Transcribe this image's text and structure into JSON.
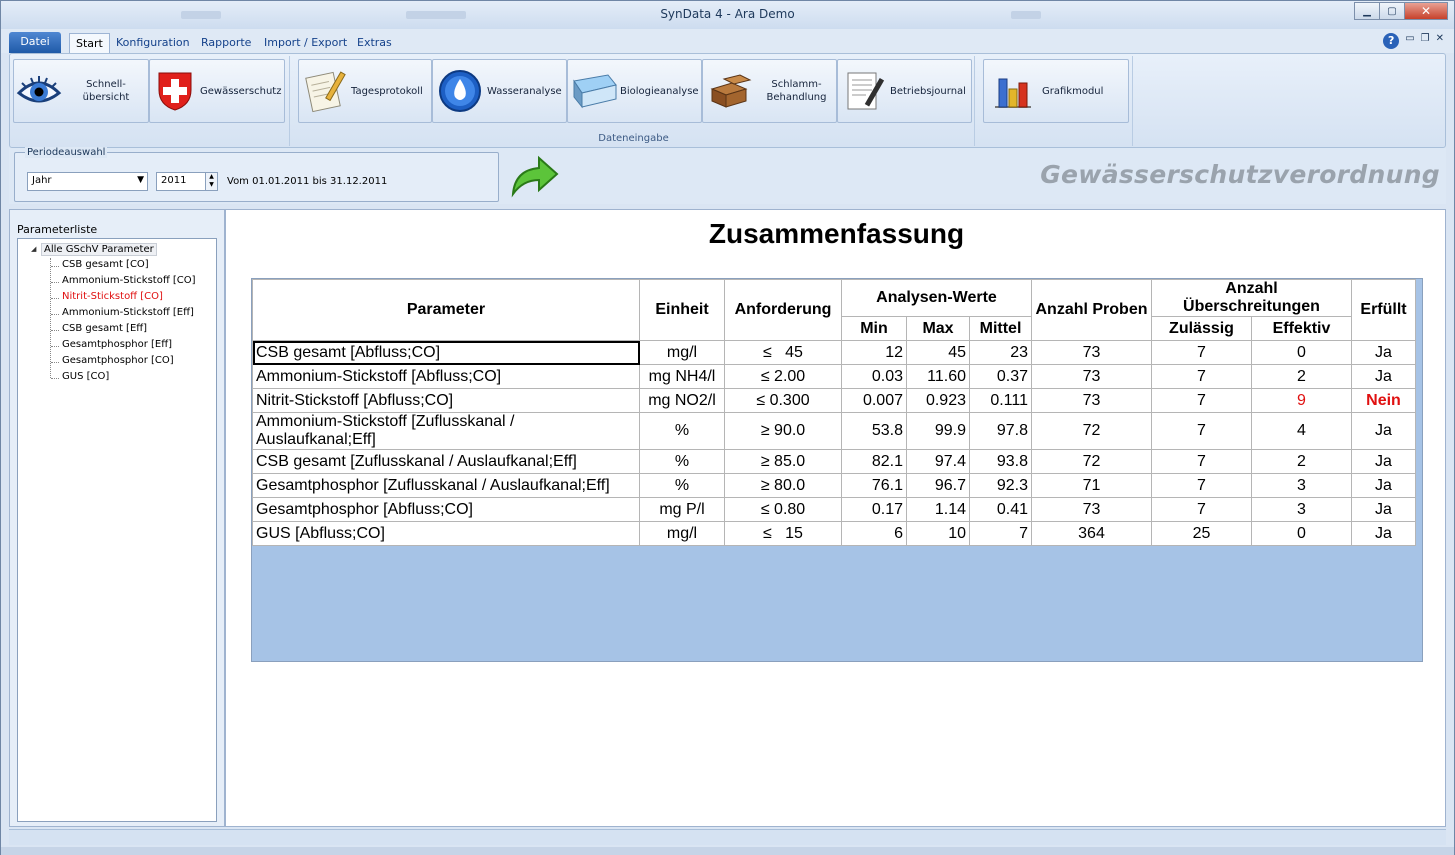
{
  "window": {
    "title": "SynData 4 - Ara Demo"
  },
  "menu": {
    "datei": "Datei",
    "tabs": [
      "Start",
      "Konfiguration",
      "Rapporte",
      "Import / Export",
      "Extras"
    ]
  },
  "ribbon": {
    "schnell": "Schnell-\nübersicht",
    "gewaesser": "Gewässerschutz",
    "tagesprotokoll": "Tagesprotokoll",
    "wasseranalyse": "Wasseranalyse",
    "biologieanalyse": "Biologieanalyse",
    "schlamm": "Schlamm-\nBehandlung",
    "betriebsjournal": "Betriebsjournal",
    "grafikmodul": "Grafikmodul",
    "group_dateneingabe": "Dateneingabe"
  },
  "period": {
    "legend": "Periodeauswahl",
    "mode": "Jahr",
    "year": "2011",
    "range": "Vom 01.01.2011 bis 31.12.2011"
  },
  "banner": "Gewässerschutzverordnung",
  "left": {
    "label": "Parameterliste",
    "root": "Alle GSchV Parameter",
    "items": [
      "CSB gesamt [CO]",
      "Ammonium-Stickstoff [CO]",
      "Nitrit-Stickstoff [CO]",
      "Ammonium-Stickstoff [Eff]",
      "CSB gesamt [Eff]",
      "Gesamtphosphor [Eff]",
      "Gesamtphosphor [CO]",
      "GUS [CO]"
    ],
    "highlight_color": "#e01010"
  },
  "summary": {
    "title": "Zusammenfassung",
    "headers": {
      "parameter": "Parameter",
      "einheit": "Einheit",
      "anforderung": "Anforderung",
      "analysen": "Analysen-Werte",
      "min": "Min",
      "max": "Max",
      "mittel": "Mittel",
      "proben": "Anzahl Proben",
      "ueber": "Anzahl Überschreitungen",
      "zulaessig": "Zulässig",
      "effektiv": "Effektiv",
      "erfuellt": "Erfüllt"
    },
    "rows": [
      [
        "CSB gesamt [Abfluss;CO]",
        "mg/l",
        "≤   45",
        "12",
        "45",
        "23",
        "73",
        "7",
        "0",
        "Ja"
      ],
      [
        "Ammonium-Stickstoff [Abfluss;CO]",
        "mg NH4/l",
        "≤ 2.00",
        "0.03",
        "11.60",
        "0.37",
        "73",
        "7",
        "2",
        "Ja"
      ],
      [
        "Nitrit-Stickstoff [Abfluss;CO]",
        "mg NO2/l",
        "≤ 0.300",
        "0.007",
        "0.923",
        "0.111",
        "73",
        "7",
        "9",
        "Nein"
      ],
      [
        "Ammonium-Stickstoff [Zuflusskanal / Auslaufkanal;Eff]",
        "%",
        "≥ 90.0",
        "53.8",
        "99.9",
        "97.8",
        "72",
        "7",
        "4",
        "Ja"
      ],
      [
        "CSB gesamt [Zuflusskanal / Auslaufkanal;Eff]",
        "%",
        "≥ 85.0",
        "82.1",
        "97.4",
        "93.8",
        "72",
        "7",
        "2",
        "Ja"
      ],
      [
        "Gesamtphosphor [Zuflusskanal / Auslaufkanal;Eff]",
        "%",
        "≥ 80.0",
        "76.1",
        "96.7",
        "92.3",
        "71",
        "7",
        "3",
        "Ja"
      ],
      [
        "Gesamtphosphor [Abfluss;CO]",
        "mg P/l",
        "≤ 0.80",
        "0.17",
        "1.14",
        "0.41",
        "73",
        "7",
        "3",
        "Ja"
      ],
      [
        "GUS [Abfluss;CO]",
        "mg/l",
        "≤   15",
        "6",
        "10",
        "7",
        "364",
        "25",
        "0",
        "Ja"
      ]
    ],
    "fail_row_index": 2,
    "fail_color": "#e01010"
  }
}
